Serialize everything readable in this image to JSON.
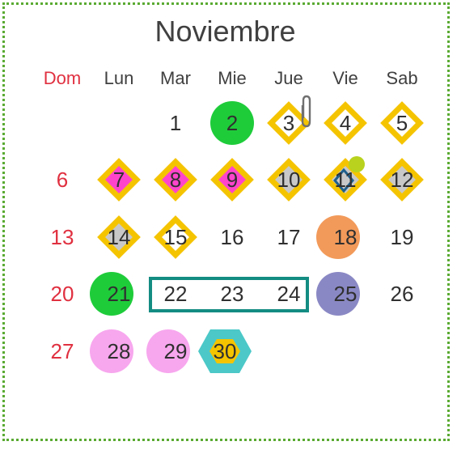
{
  "calendar": {
    "month": "Noviembre",
    "weekdays": [
      "Dom",
      "Lun",
      "Mar",
      "Mie",
      "Jue",
      "Vie",
      "Sab"
    ],
    "days": [
      "1",
      "2",
      "3",
      "4",
      "5",
      "6",
      "7",
      "8",
      "9",
      "10",
      "11",
      "12",
      "13",
      "14",
      "15",
      "16",
      "17",
      "18",
      "19",
      "20",
      "21",
      "22",
      "23",
      "24",
      "25",
      "26",
      "27",
      "28",
      "29",
      "30"
    ]
  },
  "colors": {
    "frame_dots": "#5aaa32",
    "weekend_text": "#e03040",
    "diamond_border": "#f5c400",
    "diamond_magenta": "#ff44cc",
    "diamond_light": "#c8c8c8",
    "green_circle": "#1ecc3a",
    "orange_circle": "#f29a5a",
    "purple_circle": "#8a88c4",
    "pink_circle": "#f7a7ee",
    "hexagon_outer": "#4cc8c8",
    "hexagon_inner": "#f5c400",
    "range_box": "#138c82",
    "dot": "#b8d21e"
  },
  "icons": [
    "paperclip-icon"
  ]
}
